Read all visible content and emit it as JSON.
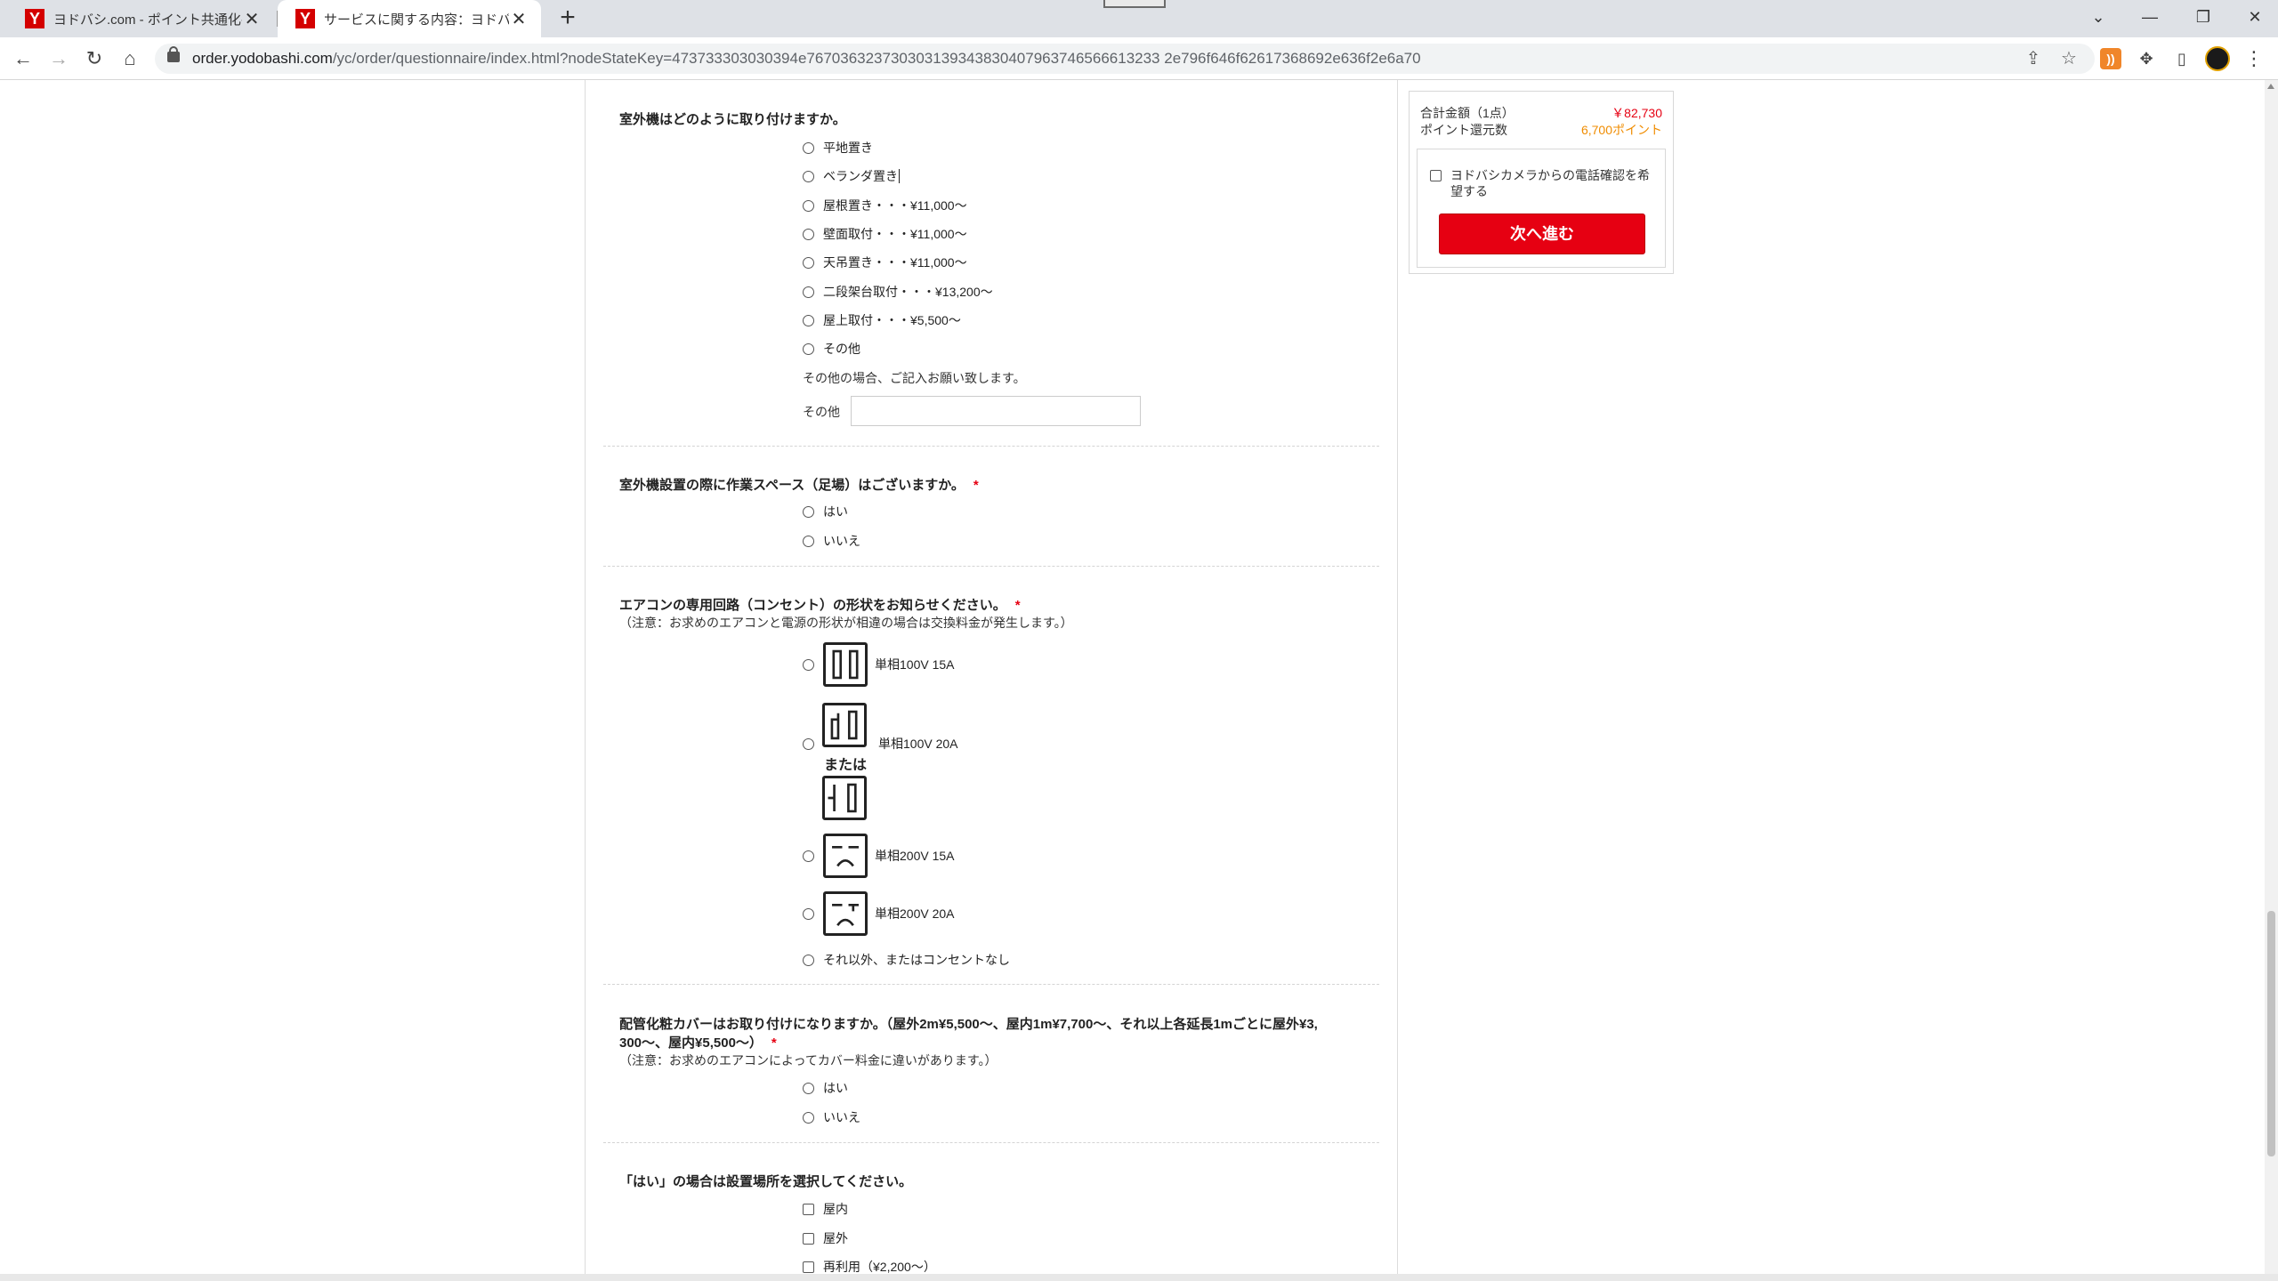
{
  "browser": {
    "tabs": [
      {
        "title": "ヨドバシ.com - ポイント共通化手続き",
        "favicon": "Y"
      },
      {
        "title": "サービスに関する内容：ヨドバシ.ドットコム",
        "favicon": "Y"
      }
    ],
    "url_host": "order.yodobashi.com",
    "url_rest": "/yc/order/questionnaire/index.html?nodeStateKey=473733303030394e767036323730303139343830407963746566613233 2e796f646f62617368692e636f2e6a70"
  },
  "questions": {
    "q1": {
      "title": "室外機はどのように取り付けますか。",
      "options": [
        "平地置き",
        "ベランダ置き",
        "屋根置き・・・¥11,000～",
        "壁面取付・・・¥11,000～",
        "天吊置き・・・¥11,000～",
        "二段架台取付・・・¥13,200～",
        "屋上取付・・・¥5,500～",
        "その他"
      ],
      "other_note": "その他の場合、ご記入お願い致します。",
      "other_label": "その他"
    },
    "q2": {
      "title": "室外機設置の際に作業スペース（足場）はございますか。",
      "required": "*",
      "options": [
        "はい",
        "いいえ"
      ]
    },
    "q3": {
      "title": "エアコンの専用回路（コンセント）の形状をお知らせください。",
      "required": "*",
      "note": "（注意：お求めのエアコンと電源の形状が相違の場合は交換料金が発生します。）",
      "options": [
        "単相100V 15A",
        "単相100V 20A",
        "単相200V 15A",
        "単相200V 20A",
        "それ以外、またはコンセントなし"
      ],
      "mataha": "または",
      "icons": [
        "outlet-100v-15a-icon",
        "outlet-100v-20a-icon",
        "outlet-100v-20a-alt-icon",
        "outlet-200v-15a-icon",
        "outlet-200v-20a-icon"
      ]
    },
    "q4": {
      "title_line1": "配管化粧カバーはお取り付けになりますか。（屋外2m¥5,500～、屋内1m¥7,700～、それ以上各延長1mごとに屋外¥3,",
      "title_line2": "300～、屋内¥5,500～）",
      "required": "*",
      "note": "（注意：お求めのエアコンによってカバー料金に違いがあります。）",
      "options": [
        "はい",
        "いいえ"
      ]
    },
    "q5": {
      "title": "「はい」の場合は設置場所を選択してください。",
      "options": [
        "屋内",
        "屋外",
        "再利用（¥2,200～）"
      ]
    }
  },
  "sidebar": {
    "total_label": "合計金額（1点）",
    "total_value": "￥82,730",
    "points_label": "ポイント還元数",
    "points_value": "6,700ポイント",
    "phone_confirm": "ヨドバシカメラからの電話確認を希望する",
    "next_button": "次へ進む"
  },
  "colors": {
    "accent": "#e60012",
    "points": "#f08c00"
  }
}
